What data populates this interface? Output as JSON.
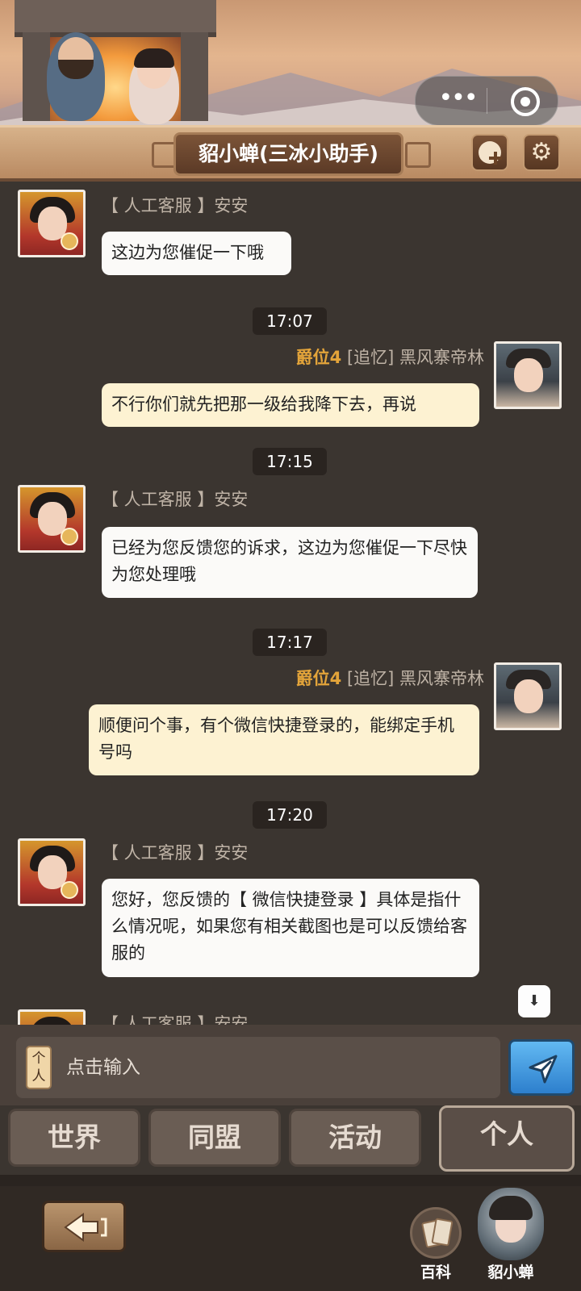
{
  "header": {
    "title": "貂小蝉(三冰小助手)",
    "menu_icon": "more-dots-icon",
    "close_icon": "record-target-icon",
    "add_icon": "plus-icon",
    "settings_icon": "gear-icon"
  },
  "messages": [
    {
      "type": "received",
      "sender": "【 人工客服 】安安",
      "text": "这边为您催促一下哦"
    },
    {
      "type": "time",
      "text": "17:07"
    },
    {
      "type": "sent",
      "rank": "爵位4",
      "sender": "[追忆] 黑风寨帝林",
      "text": "不行你们就先把那一级给我降下去，再说"
    },
    {
      "type": "time",
      "text": "17:15"
    },
    {
      "type": "received",
      "sender": "【 人工客服 】安安",
      "text": "已经为您反馈您的诉求，这边为您催促一下尽快为您处理哦"
    },
    {
      "type": "time",
      "text": "17:17"
    },
    {
      "type": "sent",
      "rank": "爵位4",
      "sender": "[追忆] 黑风寨帝林",
      "text": "顺便问个事，有个微信快捷登录的，能绑定手机号吗"
    },
    {
      "type": "time",
      "text": "17:20"
    },
    {
      "type": "received",
      "sender": "【 人工客服 】安安",
      "text": "您好，您反馈的【 微信快捷登录 】具体是指什么情况呢，如果您有相关截图也是可以反馈给客服的"
    },
    {
      "type": "received",
      "sender": "【 人工客服 】安安",
      "text": ""
    }
  ],
  "input": {
    "channel_tag": "个人",
    "placeholder": "点击输入"
  },
  "tabs": [
    {
      "label": "世界",
      "active": false
    },
    {
      "label": "同盟",
      "active": false
    },
    {
      "label": "活动",
      "active": false
    },
    {
      "label": "个人",
      "active": true
    }
  ],
  "bottom": {
    "wiki_label": "百科",
    "mascot_label": "貂小蝉"
  },
  "colors": {
    "background": "#3b3530",
    "sent_bubble": "#fdf2d2",
    "received_bubble": "#fbfaf8",
    "rank_gold": "#e3a43a",
    "send_button": "#2d7fcd"
  }
}
